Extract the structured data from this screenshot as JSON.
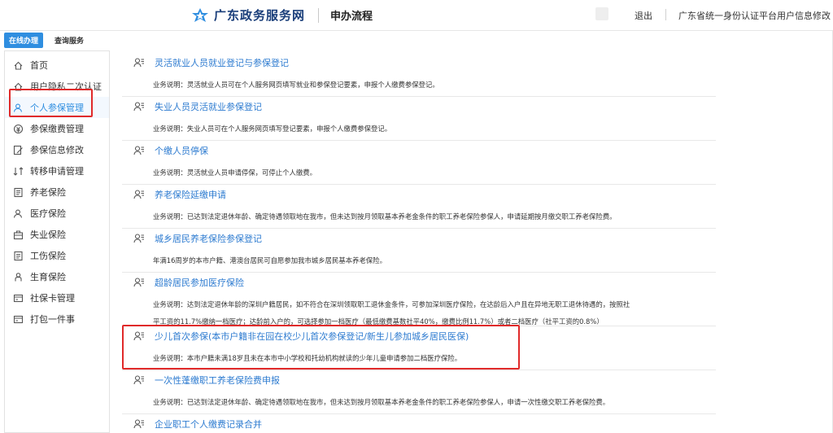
{
  "header": {
    "brand": "广东政务服务网",
    "section": "申办流程",
    "logout": "退出",
    "profile_link": "广东省统一身份认证平台用户信息修改"
  },
  "tabs": [
    "在线办理",
    "查询服务"
  ],
  "sidebar": {
    "items": [
      {
        "label": "首页",
        "icon": "home-icon"
      },
      {
        "label": "用户隐私二次认证",
        "icon": "home-icon"
      },
      {
        "label": "个人参保管理",
        "icon": "user-icon"
      },
      {
        "label": "参保缴费管理",
        "icon": "payment-icon"
      },
      {
        "label": "参保信息修改",
        "icon": "edit-icon"
      },
      {
        "label": "转移申请管理",
        "icon": "transfer-icon"
      },
      {
        "label": "养老保险",
        "icon": "document-icon"
      },
      {
        "label": "医疗保险",
        "icon": "user-icon"
      },
      {
        "label": "失业保险",
        "icon": "briefcase-icon"
      },
      {
        "label": "工伤保险",
        "icon": "document-icon"
      },
      {
        "label": "生育保险",
        "icon": "baby-icon"
      },
      {
        "label": "社保卡管理",
        "icon": "card-icon"
      },
      {
        "label": "打包一件事",
        "icon": "card-icon"
      }
    ],
    "active_index": 2
  },
  "services": [
    {
      "title": "灵活就业人员就业登记与参保登记",
      "desc": [
        "业务说明：灵活就业人员可在个人服务网页填写就业和参保登记要素，申报个人缴费参保登记。"
      ]
    },
    {
      "title": "失业人员灵活就业参保登记",
      "desc": [
        "业务说明：失业人员可在个人服务网页填写登记要素，申报个人缴费参保登记。"
      ]
    },
    {
      "title": "个缴人员停保",
      "desc": [
        "业务说明：灵活就业人员申请停保，可停止个人缴费。"
      ]
    },
    {
      "title": "养老保险延缴申请",
      "desc": [
        "业务说明：已达到法定退休年龄、确定待遇领取地在我市，但未达到按月领取基本养老金条件的职工养老保险参保人，申请延期按月缴交职工养老保险费。"
      ]
    },
    {
      "title": "城乡居民养老保险参保登记",
      "desc": [
        "年满16周岁的本市户籍、港澳台居民可自愿参加我市城乡居民基本养老保险。"
      ]
    },
    {
      "title": "超龄居民参加医疗保险",
      "desc": [
        "业务说明：达到法定退休年龄的深圳户籍居民，如不符合在深圳领取职工退休金条件，可参加深圳医疗保险，在达龄后入户且在异地无职工退休待遇的，按照社",
        "平工资的11.7%缴纳一档医疗；达龄前入户的，可选择参加一档医疗（最低缴费基数社平40%，缴费比例11.7%）或者二档医疗（社平工资的0.8%）"
      ]
    },
    {
      "title": "少儿首次参保(本市户籍非在园在校少儿首次参保登记/新生儿参加城乡居民医保)",
      "desc": [
        "业务说明：本市户籍未满18岁且未在本市中小学校和托幼机构就读的少年儿童申请参加二档医疗保险。"
      ]
    },
    {
      "title": "一次性蓬缴职工养老保险费申报",
      "desc": [
        "业务说明：已达到法定退休年龄、确定待遇领取地在我市，但未达到按月领取基本养老金条件的职工养老保险参保人，申请一次性缴交职工养老保险费。"
      ]
    },
    {
      "title": "企业职工个人缴费记录合并",
      "desc": []
    }
  ]
}
